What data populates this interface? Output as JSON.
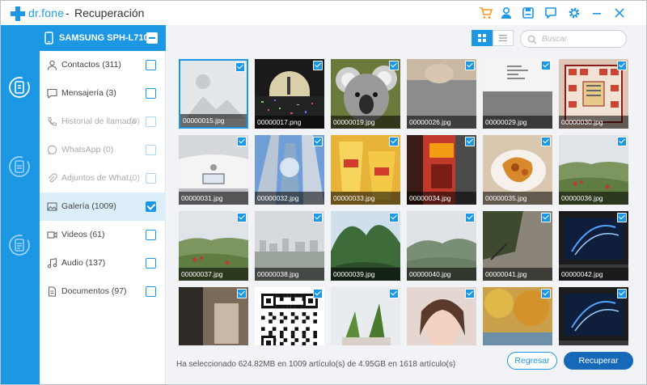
{
  "app": {
    "brand": "dr.fone",
    "separator": "-",
    "title": "Recuperación"
  },
  "titlebar_icons": [
    "cart-icon",
    "user-icon",
    "save-icon",
    "feedback-icon",
    "settings-icon",
    "minimize-icon",
    "close-icon"
  ],
  "device": {
    "name": "SAMSUNG SPH-L710"
  },
  "categories": [
    {
      "label": "Contactos (311)",
      "count": "",
      "icon": "contact-icon",
      "checked": false,
      "disabled": false
    },
    {
      "label": "Mensajería (3)",
      "count": "",
      "icon": "message-icon",
      "checked": false,
      "disabled": false
    },
    {
      "label": "Historial de llamada",
      "count": "(0)",
      "icon": "call-history-icon",
      "checked": false,
      "disabled": true
    },
    {
      "label": "WhatsApp (0)",
      "count": "",
      "icon": "whatsapp-icon",
      "checked": false,
      "disabled": true
    },
    {
      "label": "Adjuntos de What...",
      "count": "(0)",
      "icon": "attachment-icon",
      "checked": false,
      "disabled": true
    },
    {
      "label": "Galería (1009)",
      "count": "",
      "icon": "gallery-icon",
      "checked": true,
      "disabled": false
    },
    {
      "label": "Videos (61)",
      "count": "",
      "icon": "video-icon",
      "checked": false,
      "disabled": false
    },
    {
      "label": "Audio (137)",
      "count": "",
      "icon": "audio-icon",
      "checked": false,
      "disabled": false
    },
    {
      "label": "Documentos (97)",
      "count": "",
      "icon": "document-icon",
      "checked": false,
      "disabled": false
    }
  ],
  "search": {
    "placeholder": "Buscar",
    "value": ""
  },
  "thumbnails": [
    {
      "name": "00000015.jpg",
      "kind": "placeholder"
    },
    {
      "name": "00000017.png",
      "kind": "dark-noise"
    },
    {
      "name": "00000019.jpg",
      "kind": "koala"
    },
    {
      "name": "00000026.jpg",
      "kind": "gray-top-photo"
    },
    {
      "name": "00000029.jpg",
      "kind": "gray-doc"
    },
    {
      "name": "00000030.jpg",
      "kind": "grid-map"
    },
    {
      "name": "00000031.jpg",
      "kind": "white-car"
    },
    {
      "name": "00000032.jpg",
      "kind": "skyscrapers"
    },
    {
      "name": "00000033.jpg",
      "kind": "yellow-cups"
    },
    {
      "name": "00000034.jpg",
      "kind": "red-street"
    },
    {
      "name": "00000035.jpg",
      "kind": "food"
    },
    {
      "name": "00000036.jpg",
      "kind": "green-field"
    },
    {
      "name": "00000037.jpg",
      "kind": "green-field"
    },
    {
      "name": "00000038.jpg",
      "kind": "hazy-city"
    },
    {
      "name": "00000039.jpg",
      "kind": "trees-sky"
    },
    {
      "name": "00000040.jpg",
      "kind": "hills"
    },
    {
      "name": "00000041.jpg",
      "kind": "tree-gray"
    },
    {
      "name": "00000042.jpg",
      "kind": "monitor"
    },
    {
      "name": "",
      "kind": "dark-photo"
    },
    {
      "name": "",
      "kind": "qr-code"
    },
    {
      "name": "",
      "kind": "plants"
    },
    {
      "name": "",
      "kind": "girl"
    },
    {
      "name": "",
      "kind": "autumn"
    },
    {
      "name": "",
      "kind": "monitor"
    }
  ],
  "footer": {
    "status": "Ha seleccionado 624.82MB en 1009 artículo(s) de 4.95GB en 1618 artículo(s)",
    "back_label": "Regresar",
    "recover_label": "Recuperar"
  },
  "colors": {
    "accent": "#1c97e3",
    "primary_button": "#1668b8",
    "titlebar_icon_orange": "#f59a23",
    "titlebar_icon_blue": "#1c97e3"
  }
}
